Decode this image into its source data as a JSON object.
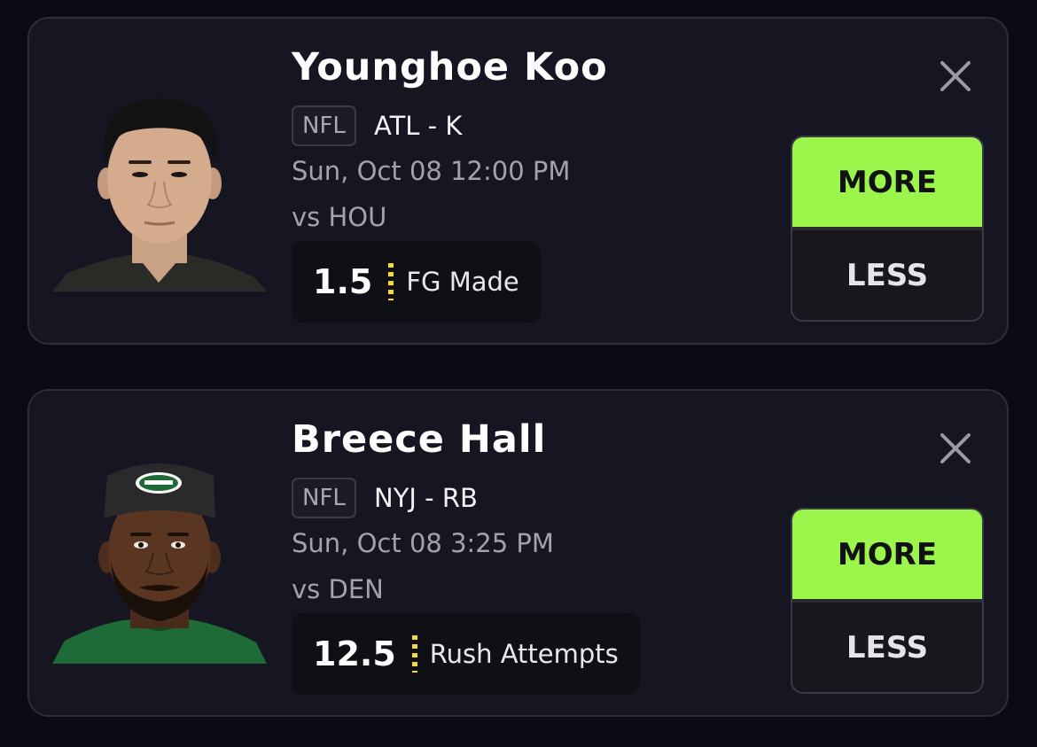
{
  "cards": [
    {
      "player_name": "Younghoe Koo",
      "league": "NFL",
      "team_position": "ATL - K",
      "game_time": "Sun, Oct 08 12:00 PM",
      "opponent": "vs HOU",
      "line_value": "1.5",
      "stat": "FG Made",
      "more_label": "MORE",
      "less_label": "LESS",
      "close_icon": "close-icon"
    },
    {
      "player_name": "Breece Hall",
      "league": "NFL",
      "team_position": "NYJ - RB",
      "game_time": "Sun, Oct 08 3:25 PM",
      "opponent": "vs DEN",
      "line_value": "12.5",
      "stat": "Rush Attempts",
      "more_label": "MORE",
      "less_label": "LESS",
      "close_icon": "close-icon"
    }
  ],
  "colors": {
    "background": "#0b0b14",
    "card": "#161622",
    "more_accent": "#9cf54a",
    "divider_accent": "#f5d936"
  }
}
